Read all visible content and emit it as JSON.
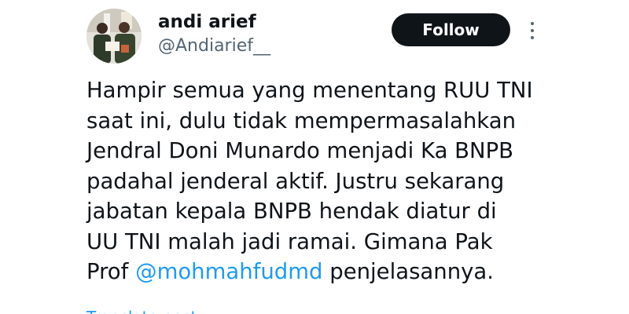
{
  "tweet": {
    "author": {
      "display_name": "andi arief",
      "handle": "@Andiarief__"
    },
    "follow_label": "Follow",
    "body": {
      "line1": "Hampir semua yang menentang RUU TNI",
      "line2": "saat ini, dulu tidak mempermasalahkan",
      "line3": "Jendral Doni Munardo menjadi Ka BNPB",
      "line4": "padahal jenderal aktif. Justru sekarang",
      "line5": "jabatan kepala BNPB hendak diatur di",
      "line6": "UU TNI malah jadi ramai. Gimana Pak",
      "line7_prefix": "Prof ",
      "mention": "@mohmahfudmd",
      "line7_suffix": " penjelasannya."
    },
    "translate_label": "Translate post"
  },
  "colors": {
    "text": "#0f1419",
    "secondary": "#536471",
    "link": "#1d9bf0",
    "button_bg": "#0f1419"
  },
  "icons": {
    "more": "more-vertical-icon"
  }
}
